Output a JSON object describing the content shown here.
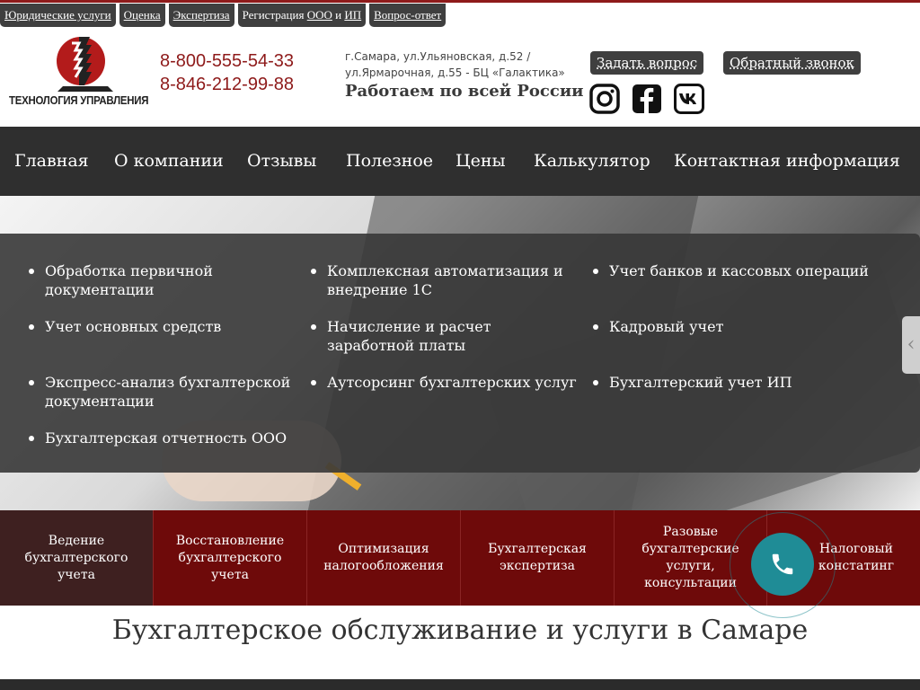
{
  "top_links": [
    {
      "label": "Юридические услуги"
    },
    {
      "label": "Оценка"
    },
    {
      "label": "Экспертиза"
    },
    {
      "label_prefix": "Регистрация ",
      "link1": "ООО",
      "mid": " и ",
      "link2": "ИП"
    },
    {
      "label": "Вопрос-ответ"
    }
  ],
  "header": {
    "logo_text": "ТЕХНОЛОГИЯ УПРАВЛЕНИЯ",
    "phone1": "8-800-555-54-33",
    "phone2": "8-846-212-99-88",
    "address_line1": "г.Самара, ул.Ульяновская, д.52 /",
    "address_line2": "ул.Ярмарочная, д.55 - БЦ «Галактика»",
    "slogan": "Работаем по всей России",
    "ask_button": "Задать вопрос",
    "callback_button": "Обратный звонок",
    "socials": [
      "instagram-icon",
      "facebook-icon",
      "vk-icon"
    ]
  },
  "nav": [
    "Главная",
    "О компании",
    "Отзывы",
    "Полезное",
    "Цены",
    "Калькулятор",
    "Контактная информация"
  ],
  "services": {
    "col1": [
      "Обработка первичной документации",
      "Учет основных средств",
      "Экспресс-анализ бухгалтерской документации",
      "Бухгалтерская отчетность ООО"
    ],
    "col2": [
      "Комплексная автоматизация и внедрение 1С",
      "Начисление и расчет заработной платы",
      "Аутсорсинг бухгалтерских услуг"
    ],
    "col3": [
      "Учет банков и кассовых операций",
      "Кадровый учет",
      "Бухгалтерский учет ИП"
    ]
  },
  "categories": [
    "Ведение бухгалтерского учета",
    "Восстановление бухгалтерского учета",
    "Оптимизация налогообложения",
    "Бухгалтерская экспертиза",
    "Разовые бухгалтерские услуги, консультации",
    "Налоговый констатинг"
  ],
  "page_title": "Бухгалтерское обслуживание и услуги в Самаре",
  "colors": {
    "brand": "#8e1a1a",
    "dark": "#3f3f3f",
    "category_bg": "#6e0a0a",
    "call_button": "#1f8c96"
  }
}
